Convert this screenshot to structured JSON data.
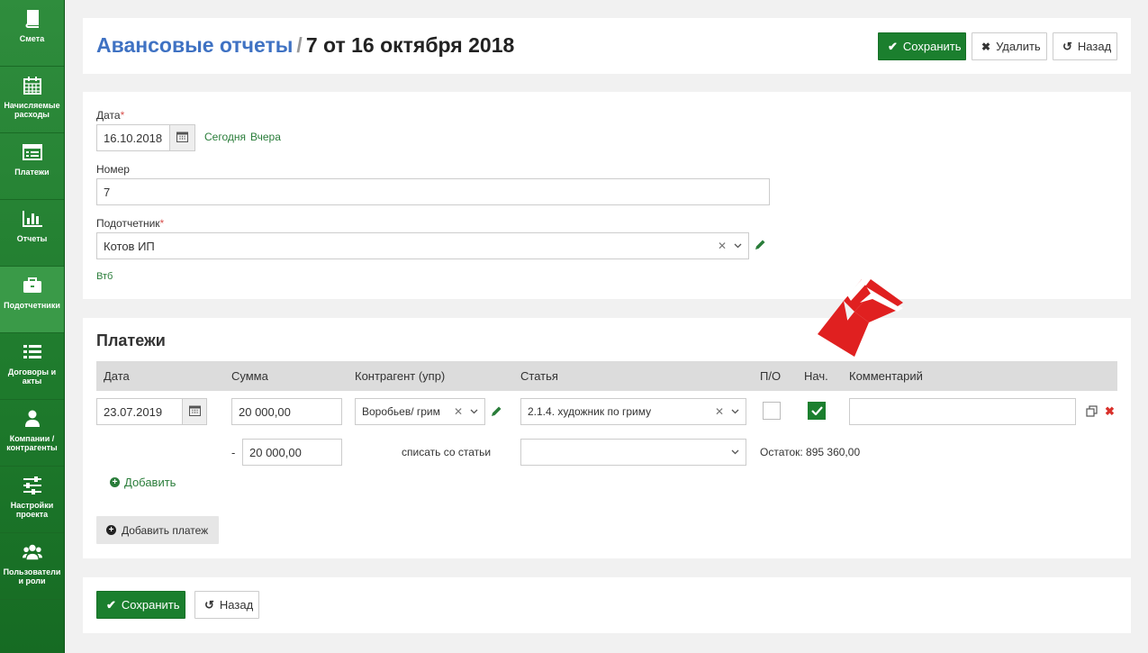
{
  "sidebar": {
    "items": [
      {
        "label": "Смета",
        "icon": "book-icon"
      },
      {
        "label": "Начисляемые расходы",
        "icon": "calendar-icon"
      },
      {
        "label": "Платежи",
        "icon": "list-card-icon"
      },
      {
        "label": "Отчеты",
        "icon": "bar-chart-icon"
      },
      {
        "label": "Подотчетники",
        "icon": "briefcase-icon"
      },
      {
        "label": "Договоры и акты",
        "icon": "list-icon"
      },
      {
        "label": "Компании / контрагенты",
        "icon": "user-icon"
      },
      {
        "label": "Настройки проекта",
        "icon": "sliders-icon"
      },
      {
        "label": "Пользователи и роли",
        "icon": "users-icon"
      }
    ]
  },
  "header": {
    "crumb": "Авансовые отчеты",
    "separator": "/",
    "doc_title": "7 от 16 октября 2018",
    "save_label": "Сохранить",
    "delete_label": "Удалить",
    "back_label": "Назад"
  },
  "form": {
    "date_label": "Дата",
    "required_mark": "*",
    "date_value": "16.10.2018",
    "today_link": "Сегодня",
    "yesterday_link": "Вчера",
    "number_label": "Номер",
    "number_value": "7",
    "person_label": "Подотчетник",
    "person_value": "Котов ИП",
    "bank_link": "Втб"
  },
  "payments": {
    "title": "Платежи",
    "columns": {
      "date": "Дата",
      "sum": "Сумма",
      "counterparty": "Контрагент (упр)",
      "article": "Статья",
      "po": "П/О",
      "nach": "Нач.",
      "comment": "Комментарий"
    },
    "row": {
      "date": "23.07.2019",
      "sum": "20 000,00",
      "counterparty": "Воробьев/ грим",
      "article": "2.1.4. художник по гриму",
      "po_checked": false,
      "nach_checked": true,
      "comment": ""
    },
    "writeoff": {
      "minus": "-",
      "sum": "20 000,00",
      "label": "списать со статьи",
      "article": "",
      "remainder": "Остаток: 895 360,00"
    },
    "add_link": "Добавить",
    "add_payment_label": "Добавить платеж"
  },
  "footer": {
    "save_label": "Сохранить",
    "back_label": "Назад"
  },
  "colors": {
    "accent_green": "#1b7f2e",
    "link_blue": "#3f72c3",
    "annotation_red": "#e02020"
  }
}
